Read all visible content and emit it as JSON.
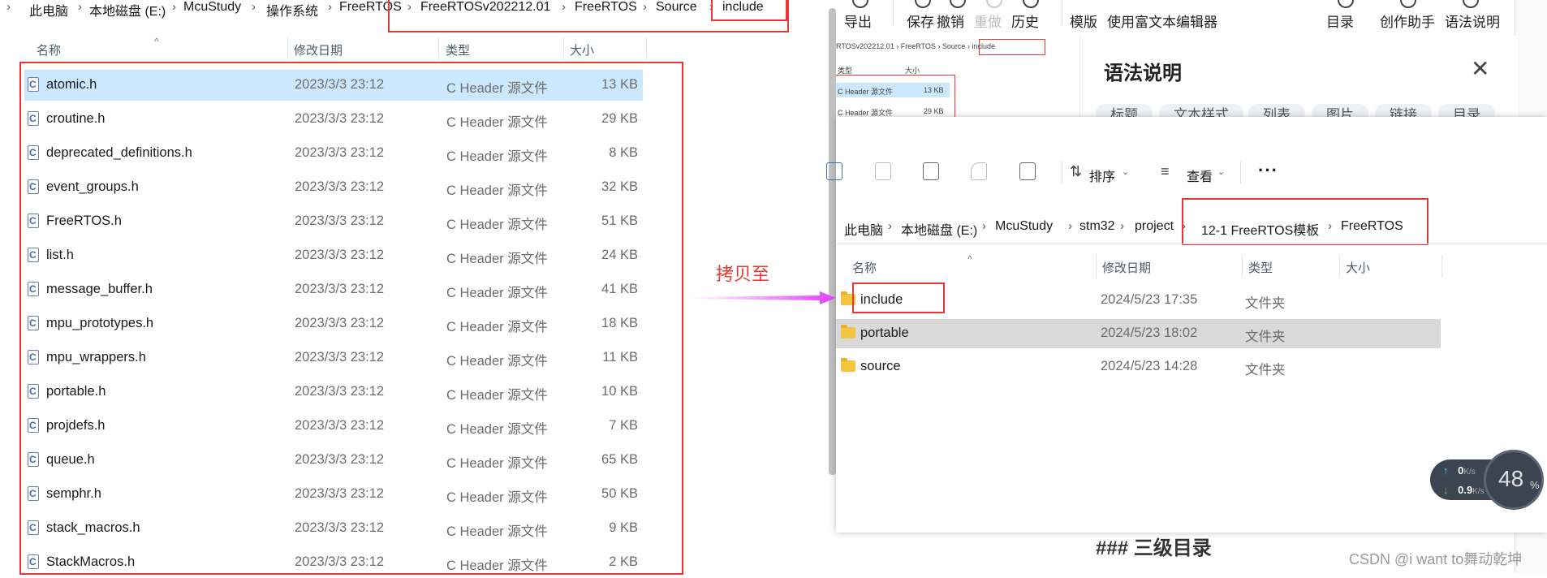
{
  "left_explorer": {
    "breadcrumb": [
      "此电脑",
      "本地磁盘 (E:)",
      "McuStudy",
      "操作系统",
      "FreeRTOS",
      "FreeRTOSv202212.01",
      "FreeRTOS",
      "Source",
      "include"
    ],
    "columns": {
      "name": "名称",
      "date": "修改日期",
      "type": "类型",
      "size": "大小"
    },
    "files": [
      {
        "name": "atomic.h",
        "date": "2023/3/3 23:12",
        "type": "C Header 源文件",
        "size": "13 KB"
      },
      {
        "name": "croutine.h",
        "date": "2023/3/3 23:12",
        "type": "C Header 源文件",
        "size": "29 KB"
      },
      {
        "name": "deprecated_definitions.h",
        "date": "2023/3/3 23:12",
        "type": "C Header 源文件",
        "size": "8 KB"
      },
      {
        "name": "event_groups.h",
        "date": "2023/3/3 23:12",
        "type": "C Header 源文件",
        "size": "32 KB"
      },
      {
        "name": "FreeRTOS.h",
        "date": "2023/3/3 23:12",
        "type": "C Header 源文件",
        "size": "51 KB"
      },
      {
        "name": "list.h",
        "date": "2023/3/3 23:12",
        "type": "C Header 源文件",
        "size": "24 KB"
      },
      {
        "name": "message_buffer.h",
        "date": "2023/3/3 23:12",
        "type": "C Header 源文件",
        "size": "41 KB"
      },
      {
        "name": "mpu_prototypes.h",
        "date": "2023/3/3 23:12",
        "type": "C Header 源文件",
        "size": "18 KB"
      },
      {
        "name": "mpu_wrappers.h",
        "date": "2023/3/3 23:12",
        "type": "C Header 源文件",
        "size": "11 KB"
      },
      {
        "name": "portable.h",
        "date": "2023/3/3 23:12",
        "type": "C Header 源文件",
        "size": "10 KB"
      },
      {
        "name": "projdefs.h",
        "date": "2023/3/3 23:12",
        "type": "C Header 源文件",
        "size": "7 KB"
      },
      {
        "name": "queue.h",
        "date": "2023/3/3 23:12",
        "type": "C Header 源文件",
        "size": "65 KB"
      },
      {
        "name": "semphr.h",
        "date": "2023/3/3 23:12",
        "type": "C Header 源文件",
        "size": "50 KB"
      },
      {
        "name": "stack_macros.h",
        "date": "2023/3/3 23:12",
        "type": "C Header 源文件",
        "size": "9 KB"
      },
      {
        "name": "StackMacros.h",
        "date": "2023/3/3 23:12",
        "type": "C Header 源文件",
        "size": "2 KB"
      }
    ]
  },
  "annotation": {
    "copy_label": "拷贝至",
    "accent": "#e53935",
    "arrow_color": "#e040fb"
  },
  "editor": {
    "toolbar": [
      "导出",
      "保存",
      "撤销",
      "重做",
      "历史",
      "模版",
      "使用富文本编辑器",
      "目录",
      "创作助手",
      "语法说明"
    ],
    "mini_breadcrumb": [
      "RTOSv202212.01",
      "FreeRTOS",
      "Source",
      "include"
    ],
    "mini_cols": {
      "type": "类型",
      "size": "大小"
    },
    "mini_rows": [
      {
        "type": "C Header 源文件",
        "size": "13 KB"
      },
      {
        "type": "C Header 源文件",
        "size": "29 KB"
      }
    ],
    "syntax_title": "语法说明",
    "close_symbol": "✕",
    "chips": [
      "标题",
      "文本样式",
      "列表",
      "图片",
      "链接",
      "目录"
    ],
    "heading": "### 三级目录",
    "watermark": "CSDN @i want to舞动乾坤"
  },
  "right_explorer": {
    "toolbar": {
      "sort": "排序",
      "view": "查看",
      "more": "···"
    },
    "breadcrumb": [
      "此电脑",
      "本地磁盘 (E:)",
      "McuStudy",
      "stm32",
      "project",
      "12-1 FreeRTOS模板",
      "FreeRTOS"
    ],
    "columns": {
      "name": "名称",
      "date": "修改日期",
      "type": "类型",
      "size": "大小"
    },
    "folders": [
      {
        "name": "include",
        "date": "2024/5/23 17:35",
        "type": "文件夹"
      },
      {
        "name": "portable",
        "date": "2024/5/23 18:02",
        "type": "文件夹"
      },
      {
        "name": "source",
        "date": "2024/5/23 14:28",
        "type": "文件夹"
      }
    ]
  },
  "network": {
    "up": "0",
    "up_unit": "K/s",
    "down": "0.9",
    "down_unit": "K/s",
    "percent": "48",
    "percent_symbol": "%"
  }
}
